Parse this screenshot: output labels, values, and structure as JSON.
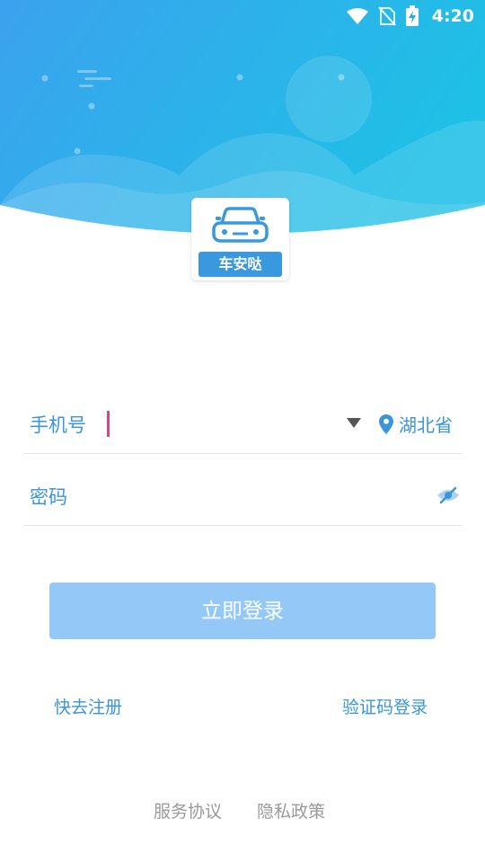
{
  "status_bar": {
    "time": "4:20"
  },
  "logo": {
    "label": "车安哒"
  },
  "form": {
    "phone_label": "手机号",
    "phone_value": "",
    "province": "湖北省",
    "password_label": "密码",
    "password_value": ""
  },
  "actions": {
    "login_label": "立即登录",
    "register_label": "快去注册",
    "code_login_label": "验证码登录"
  },
  "footer": {
    "service_agreement": "服务协议",
    "privacy_policy": "隐私政策"
  },
  "colors": {
    "header_gradient_start": "#3aa1ec",
    "header_gradient_end": "#22b9e8",
    "accent": "#3a95dc",
    "button_disabled": "#94c9f7",
    "cursor": "#e0427a"
  }
}
